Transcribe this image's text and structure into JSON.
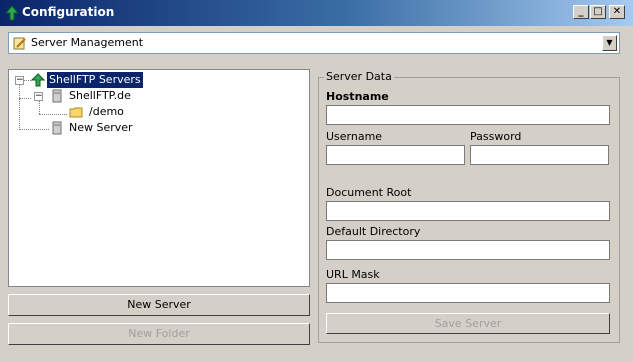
{
  "window": {
    "title": "Configuration",
    "minimize": "_",
    "maximize": "□",
    "close": "✕"
  },
  "profile_select": {
    "value": "Server Management",
    "icon": "pencil-note-icon"
  },
  "tree": {
    "root": "ShellFTP Servers",
    "children": [
      {
        "label": "ShellFTP.de",
        "children": [
          {
            "label": "/demo"
          }
        ]
      },
      {
        "label": "New Server"
      }
    ]
  },
  "buttons": {
    "new_server": "New Server",
    "new_folder": "New Folder",
    "save_server": "Save Server"
  },
  "server_data": {
    "group_title": "Server Data",
    "hostname_label": "Hostname",
    "hostname_value": "",
    "username_label": "Username",
    "username_value": "",
    "password_label": "Password",
    "password_value": "",
    "docroot_label": "Document Root",
    "docroot_value": "",
    "default_dir_label": "Default Directory",
    "default_dir_value": "",
    "url_mask_label": "URL Mask",
    "url_mask_value": ""
  }
}
